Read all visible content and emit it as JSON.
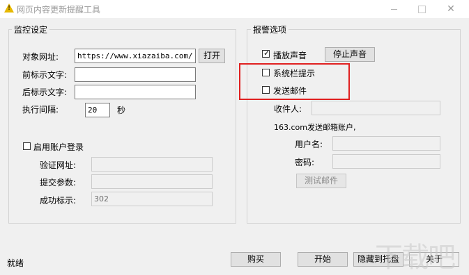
{
  "window": {
    "title": "网页内容更新提醒工具",
    "minimize_glyph": "—",
    "close_glyph": "✕"
  },
  "monitor": {
    "group_title": "监控设定",
    "url_label": "对象网址:",
    "url_value": "https://www.xiazaiba.com/",
    "open_button": "打开",
    "prefix_label": "前标示文字:",
    "prefix_value": "",
    "suffix_label": "后标示文字:",
    "suffix_value": "",
    "interval_label": "执行间隔:",
    "interval_value": "20",
    "interval_unit": "秒",
    "login_checkbox_label": "启用账户登录",
    "login_checked": false,
    "verify_url_label": "验证网址:",
    "verify_url_value": "",
    "submit_params_label": "提交参数:",
    "submit_params_value": "",
    "success_label": "成功标示:",
    "success_value": "302"
  },
  "alarm": {
    "group_title": "报警选项",
    "play_sound_label": "播放声音",
    "play_sound_checked": true,
    "stop_sound_button": "停止声音",
    "tray_tip_label": "系统栏提示",
    "tray_tip_checked": false,
    "send_mail_label": "发送邮件",
    "send_mail_checked": false,
    "recipient_label": "收件人:",
    "recipient_value": "",
    "sender_account_label": "163.com发送邮箱账户,",
    "username_label": "用户名:",
    "username_value": "",
    "password_label": "密码:",
    "password_value": "",
    "test_mail_button": "测试邮件"
  },
  "footer": {
    "status": "就绪",
    "buy_button": "购买",
    "start_button": "开始",
    "hide_tray_button": "隐藏到托盘",
    "about_button": "关于"
  },
  "colors": {
    "highlight": "#e02020",
    "window_bg": "#f0f0f0"
  },
  "watermark": "下载吧"
}
